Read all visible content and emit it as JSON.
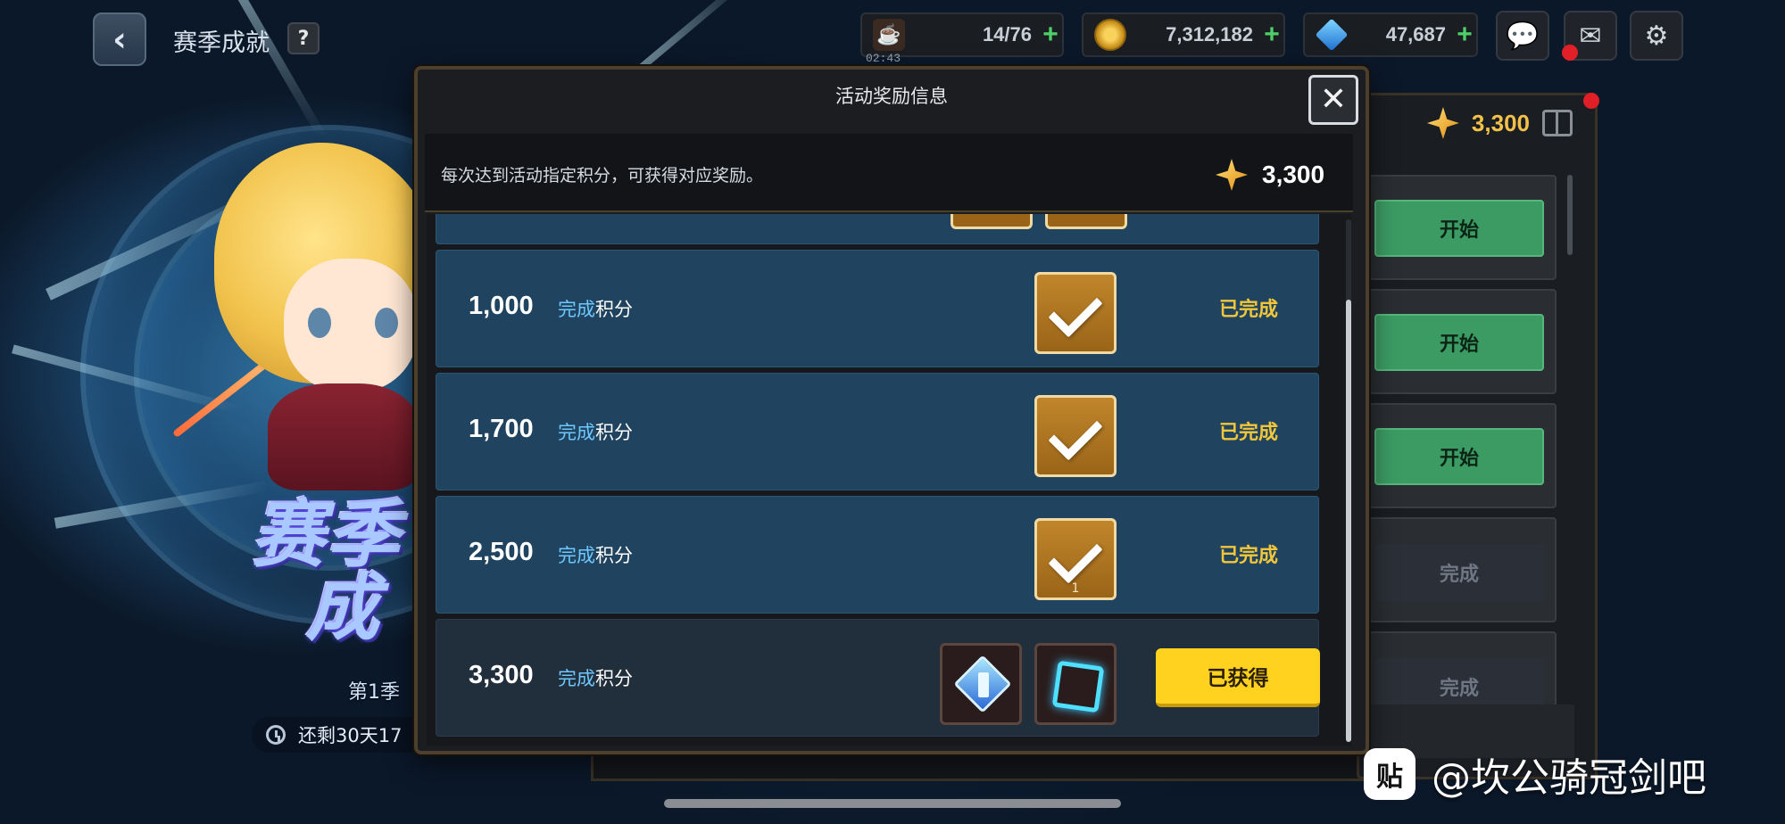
{
  "colors": {
    "accent_gold": "#f2c63a",
    "claim_button": "#ffd21f",
    "row_completed": "#20445f",
    "row_claimed": "#212e3b",
    "start_button": "#3b9b62",
    "highlight_blue": "#6ec8ff"
  },
  "top_bar": {
    "title": "赛季成就",
    "back_icon": "chevron-left-icon",
    "help_label": "?",
    "stamina": {
      "value": "14/76",
      "timer": "02:43",
      "icon": "coffee-cup-icon"
    },
    "gold": {
      "value": "7,312,182",
      "icon": "gold-coin-icon"
    },
    "gems": {
      "value": "47,687",
      "icon": "blue-gem-icon"
    },
    "plus_label": "+",
    "chat_icon": "chat-bubble-icon",
    "mail_icon": "mail-icon",
    "settings_icon": "gear-icon"
  },
  "hero_banner": {
    "title_line1": "赛季",
    "title_line2": "成",
    "season": "第1季",
    "remaining": "还剩30天17"
  },
  "side_panel": {
    "points": "3,300",
    "buttons": [
      {
        "label": "开始",
        "state": "start"
      },
      {
        "label": "开始",
        "state": "start"
      },
      {
        "label": "开始",
        "state": "start"
      },
      {
        "label": "完成",
        "state": "done"
      },
      {
        "label": "完成",
        "state": "done"
      }
    ]
  },
  "modal": {
    "title": "活动奖励信息",
    "close_label": "✕",
    "info_text": "每次达到活动指定积分，可获得对应奖励。",
    "current_points": "3,300",
    "label_highlight": "完成",
    "label_suffix": "积分",
    "rows": [
      {
        "points": "1,000",
        "status": "已完成",
        "reward_count": ""
      },
      {
        "points": "1,700",
        "status": "已完成",
        "reward_count": ""
      },
      {
        "points": "2,500",
        "status": "已完成",
        "reward_count": "1"
      },
      {
        "points": "3,300",
        "status": "已获得"
      }
    ]
  },
  "watermark": {
    "logo_text": "贴",
    "text": "@坎公骑冠剑吧"
  }
}
